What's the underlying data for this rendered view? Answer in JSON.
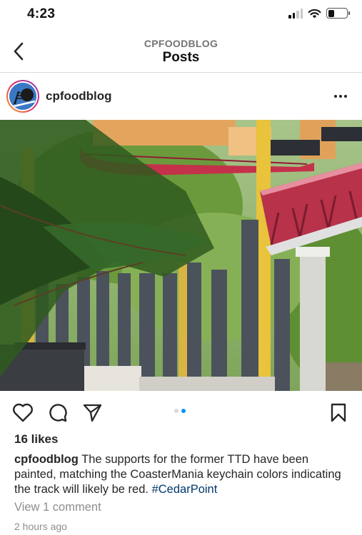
{
  "status_bar": {
    "time": "4:23",
    "icons": [
      "cellular-signal-icon",
      "wifi-icon",
      "battery-icon"
    ],
    "battery_level": 0.35
  },
  "header": {
    "subtitle": "CPFOODBLOG",
    "title": "Posts",
    "back_icon": "chevron-left-icon"
  },
  "post": {
    "username": "cpfoodblog",
    "more_icon": "more-horizontal-icon",
    "carousel": {
      "count": 2,
      "active_index": 1
    },
    "actions": [
      "heart-icon",
      "comment-icon",
      "share-icon",
      "bookmark-icon"
    ],
    "likes": "16 likes",
    "caption": {
      "username": "cpfoodblog",
      "text": "The supports for the former TTD have been painted, matching the CoasterMania keychain colors indicating the track will likely be red.",
      "hashtag": "#CedarPoint"
    },
    "view_comments": "View 1 comment",
    "timestamp": "2 hours ago"
  },
  "colors": {
    "link_blue": "#00376b",
    "accent_blue": "#0095f6",
    "muted_text": "#8e8e8e",
    "track_red": "#c4314a",
    "support_gray": "#4c525c",
    "support_yellow": "#e8c33b"
  }
}
